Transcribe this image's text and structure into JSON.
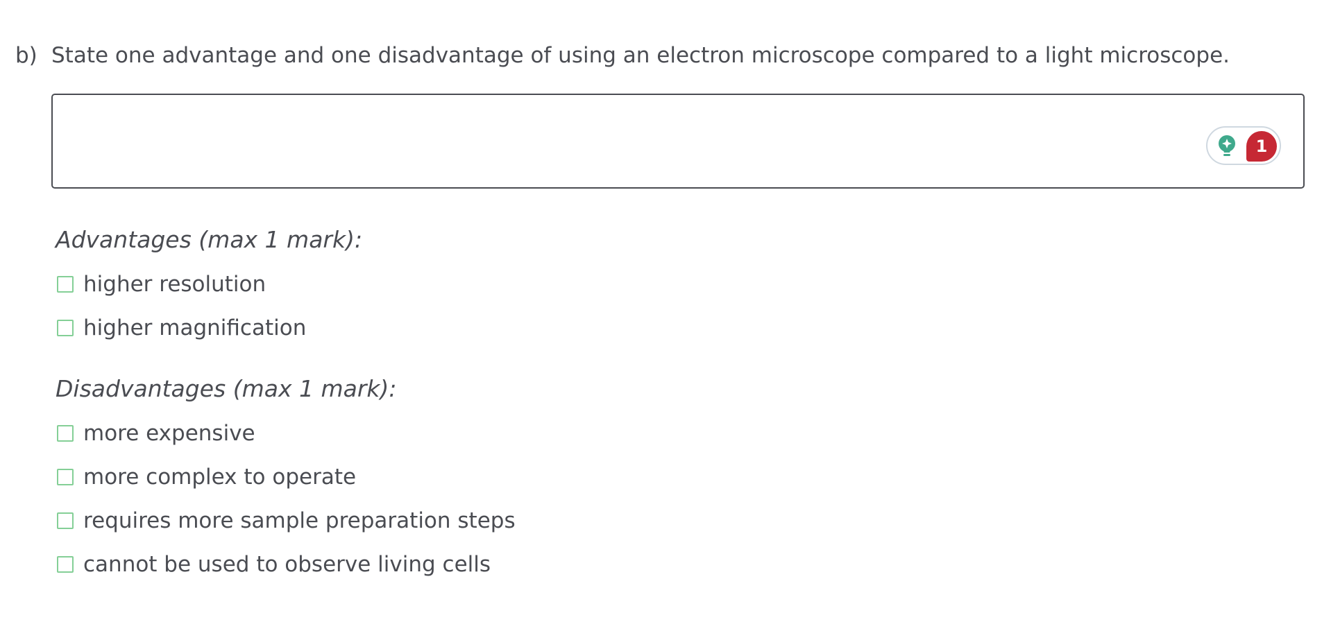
{
  "question": {
    "label": "b)",
    "text": "State one advantage and one disadvantage of using an electron microscope compared to a light microscope."
  },
  "answer_box": {
    "value": "",
    "hint_icon": "lightbulb-sparkle-icon",
    "hint_color": "#3fa98c",
    "badge_count": "1",
    "badge_color": "#c62834"
  },
  "advantages": {
    "title": "Advantages",
    "subtitle": "(max 1 mark):",
    "items": [
      {
        "label": "higher resolution",
        "checked": false
      },
      {
        "label": "higher magnification",
        "checked": false
      }
    ]
  },
  "disadvantages": {
    "title": "Disadvantages",
    "subtitle": "(max 1 mark):",
    "items": [
      {
        "label": "more expensive",
        "checked": false
      },
      {
        "label": "more complex to operate",
        "checked": false
      },
      {
        "label": "requires more sample preparation steps",
        "checked": false
      },
      {
        "label": "cannot be used to observe living cells",
        "checked": false
      }
    ]
  },
  "colors": {
    "checkbox_border": "#84cf96",
    "text": "#4a4c52"
  }
}
